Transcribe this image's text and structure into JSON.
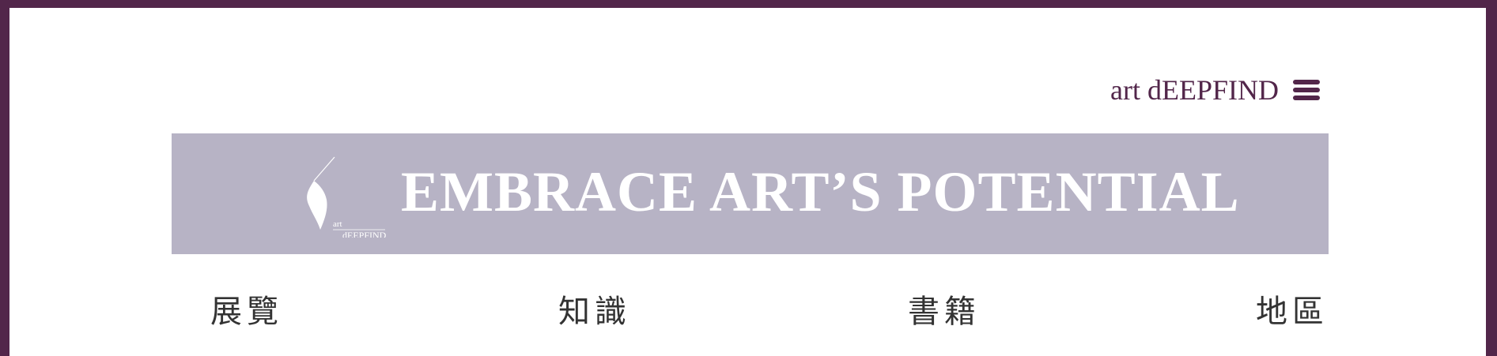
{
  "header": {
    "brand": "art dEEPFIND",
    "menu_icon": "hamburger-menu-icon"
  },
  "banner": {
    "logo_text_small": "art",
    "logo_text_main": "dEEPFIND",
    "title": "EMBRACE ART’S POTENTIAL"
  },
  "nav": {
    "items": [
      {
        "label": "展覽"
      },
      {
        "label": "知識"
      },
      {
        "label": "書籍"
      },
      {
        "label": "地區"
      }
    ]
  },
  "colors": {
    "frame": "#52264a",
    "banner_bg": "#b7b3c5",
    "brand_text": "#52264a"
  }
}
